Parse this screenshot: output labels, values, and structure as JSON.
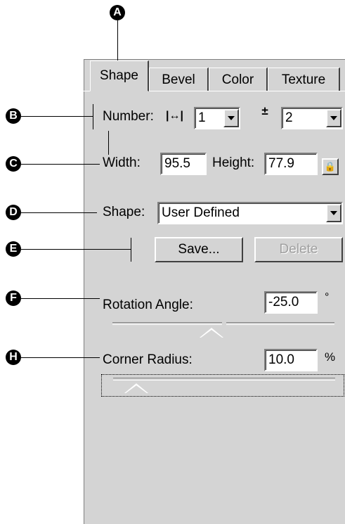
{
  "callouts": [
    "A",
    "B",
    "C",
    "D",
    "E",
    "F",
    "H"
  ],
  "tabs": [
    "Shape",
    "Bevel",
    "Color",
    "Texture"
  ],
  "number": {
    "label": "Number:",
    "horizontal_value": "1",
    "vertical_value": "2"
  },
  "size": {
    "width_label": "Width:",
    "width_value": "95.5",
    "height_label": "Height:",
    "height_value": "77.9"
  },
  "shape": {
    "label": "Shape:",
    "value": "User Defined"
  },
  "buttons": {
    "save": "Save...",
    "delete": "Delete"
  },
  "rotation": {
    "label": "Rotation Angle:",
    "value": "-25.0",
    "unit": "°",
    "slider_fraction": 0.5
  },
  "corner": {
    "label": "Corner Radius:",
    "value": "10.0",
    "unit": "%",
    "slider_fraction": 0.1
  }
}
